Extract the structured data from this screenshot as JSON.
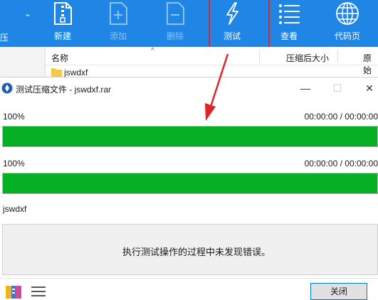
{
  "toolbar": {
    "left_partial_label": "压",
    "buttons": [
      {
        "label": "新建",
        "icon": "zip-file-icon",
        "enabled": true
      },
      {
        "label": "添加",
        "icon": "add-file-icon",
        "enabled": false
      },
      {
        "label": "删除",
        "icon": "delete-file-icon",
        "enabled": false
      },
      {
        "label": "测试",
        "icon": "lightning-icon",
        "enabled": true
      },
      {
        "label": "查看",
        "icon": "list-view-icon",
        "enabled": true
      },
      {
        "label": "代码页",
        "icon": "globe-icon",
        "enabled": true
      }
    ]
  },
  "file_list": {
    "columns": {
      "name": "名称",
      "packed_size": "压缩后大小",
      "original_size": "原始"
    },
    "rows": [
      {
        "name": "jswdxf"
      }
    ]
  },
  "dialog": {
    "title": "测试压缩文件 - jswdxf.rar",
    "progress_total": {
      "percent_label": "100%",
      "time": "00:00:00 / 00:00:00",
      "value": 1.0
    },
    "progress_file": {
      "percent_label": "100%",
      "time": "00:00:00 / 00:00:00",
      "value": 1.0
    },
    "current_file": "jswdxf",
    "message": "执行测试操作的过程中未发现错误。",
    "close_label": "关闭"
  },
  "colors": {
    "toolbar": "#1f86e6",
    "progress": "#06b025",
    "annotation": "#e02525"
  }
}
